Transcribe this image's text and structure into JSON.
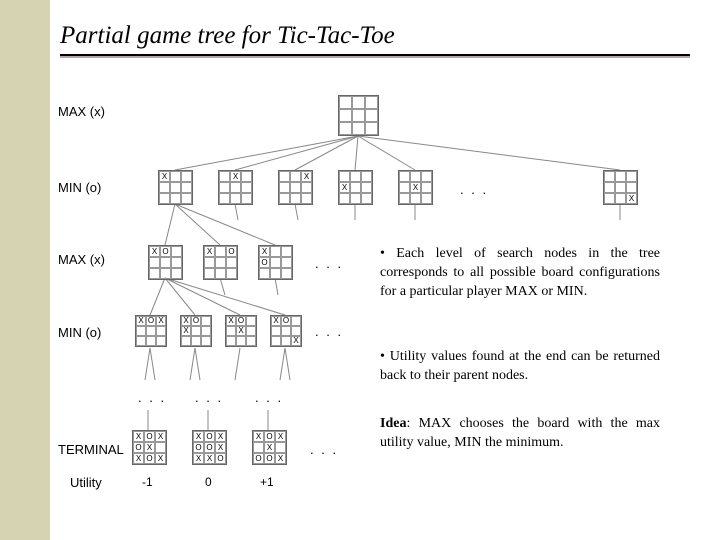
{
  "title": "Partial game tree for Tic-Tac-Toe",
  "labels": {
    "max_x": "MAX (x)",
    "min_o": "MIN (o)",
    "terminal": "TERMINAL",
    "utility": "Utility"
  },
  "utility_values": [
    "-1",
    "0",
    "+1"
  ],
  "ellipsis": ". . .",
  "note1": "• Each level of search nodes in the tree corresponds to all possible board configurations for a particular player MAX or MIN.",
  "note2": "• Utility values found at the end can be returned back to their parent nodes.",
  "note3_prefix": "Idea",
  "note3_rest": ": MAX chooses the board with the max utility value, MIN the minimum.",
  "boards": {
    "root": [
      "",
      "",
      "",
      "",
      "",
      "",
      "",
      "",
      ""
    ],
    "l1": [
      [
        "X",
        "",
        "",
        "",
        "",
        "",
        "",
        "",
        ""
      ],
      [
        "",
        "X",
        "",
        "",
        "",
        "",
        "",
        "",
        ""
      ],
      [
        "",
        "",
        "X",
        "",
        "",
        "",
        "",
        "",
        ""
      ],
      [
        "",
        "",
        "",
        "X",
        "",
        "",
        "",
        "",
        ""
      ],
      [
        "",
        "",
        "",
        "",
        "X",
        "",
        "",
        "",
        ""
      ],
      [
        "",
        "",
        "",
        "",
        "",
        "",
        "",
        "",
        "X"
      ]
    ],
    "l2": [
      [
        "X",
        "O",
        "",
        "",
        "",
        "",
        "",
        "",
        ""
      ],
      [
        "X",
        "",
        "O",
        "",
        "",
        "",
        "",
        "",
        ""
      ],
      [
        "X",
        "",
        "",
        "O",
        "",
        "",
        "",
        "",
        ""
      ]
    ],
    "l3": [
      [
        "X",
        "O",
        "X",
        "",
        "",
        "",
        "",
        "",
        ""
      ],
      [
        "X",
        "O",
        "",
        "X",
        "",
        "",
        "",
        "",
        ""
      ],
      [
        "X",
        "O",
        "",
        "",
        "X",
        "",
        "",
        "",
        ""
      ],
      [
        "X",
        "O",
        "",
        "",
        "",
        "",
        "",
        "",
        "X"
      ]
    ],
    "term": [
      [
        "X",
        "O",
        "X",
        "O",
        "X",
        "",
        "X",
        "O",
        "X"
      ],
      [
        "X",
        "O",
        "X",
        "O",
        "O",
        "X",
        "X",
        "X",
        "O"
      ],
      [
        "X",
        "O",
        "X",
        "",
        "X",
        "",
        "O",
        "O",
        "X"
      ]
    ]
  },
  "chart_data": {
    "type": "tree",
    "title": "Partial game tree for Tic-Tac-Toe",
    "levels": [
      {
        "player": "MAX (x)",
        "description": "empty root board"
      },
      {
        "player": "MIN (o)",
        "branching": 9,
        "shown": 6,
        "x_positions": [
          0,
          1,
          2,
          3,
          4,
          8
        ]
      },
      {
        "player": "MAX (x)",
        "shown": 3,
        "o_positions_given_x_at_0": [
          1,
          2,
          3
        ]
      },
      {
        "player": "MIN (o)",
        "shown": 4
      },
      {
        "player": "TERMINAL",
        "shown": 3,
        "utilities": [
          -1,
          0,
          1
        ]
      }
    ]
  }
}
